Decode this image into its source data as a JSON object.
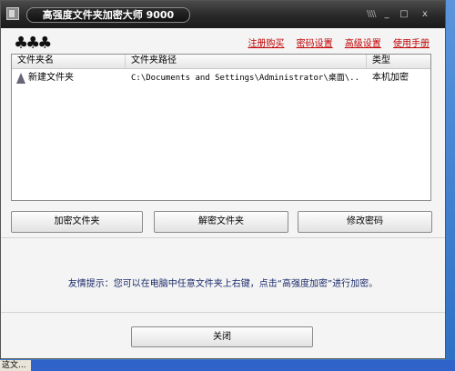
{
  "window": {
    "title": "高强度文件夹加密大师 9000"
  },
  "titlebar": {
    "grip": "\\\\\\\\",
    "minimize": "_",
    "maximize": "□",
    "close": "x"
  },
  "logo": {
    "symbol": "♣♣♣"
  },
  "menu": {
    "items": [
      "注册购买",
      "密码设置",
      "高级设置",
      "使用手册"
    ]
  },
  "list": {
    "columns": [
      "文件夹名",
      "文件夹路径",
      "类型"
    ],
    "rows": [
      {
        "name": "新建文件夹",
        "path": "C:\\Documents and Settings\\Administrator\\桌面\\...",
        "type": "本机加密"
      }
    ]
  },
  "buttons": {
    "encrypt": "加密文件夹",
    "decrypt": "解密文件夹",
    "change_password": "修改密码",
    "close": "关闭"
  },
  "tip": {
    "text": "友情提示：您可以在电脑中任意文件夹上右键，点击“高强度加密”进行加密。"
  },
  "taskbar": {
    "item": "这文..."
  }
}
